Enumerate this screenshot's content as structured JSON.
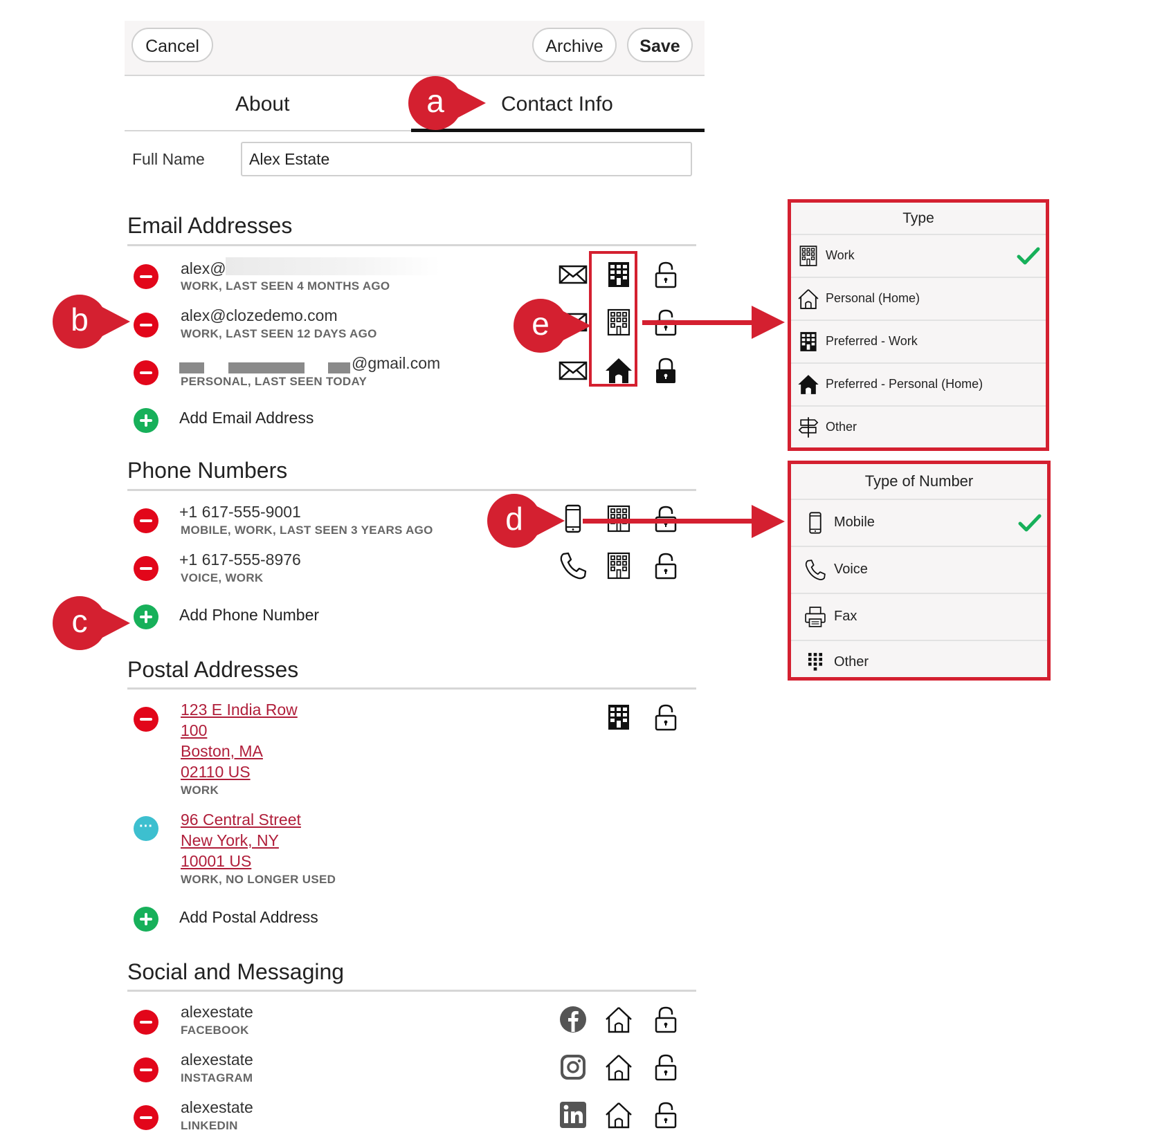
{
  "toolbar": {
    "cancel": "Cancel",
    "archive": "Archive",
    "save": "Save"
  },
  "tabs": {
    "about": "About",
    "contact_info": "Contact Info",
    "active": "contact_info"
  },
  "full_name": {
    "label": "Full Name",
    "value": "Alex Estate"
  },
  "email": {
    "title": "Email Addresses",
    "items": [
      {
        "address": "alex@",
        "meta": "WORK, LAST SEEN 4 MONTHS AGO",
        "type_icon": "building-icon"
      },
      {
        "address": "alex@clozedemo.com",
        "meta": "WORK, LAST SEEN 12 DAYS AGO",
        "type_icon": "building-icon"
      },
      {
        "address": "@gmail.com",
        "meta": "PERSONAL, LAST SEEN TODAY",
        "type_icon": "home-solid-icon"
      }
    ],
    "add": "Add Email Address"
  },
  "phone": {
    "title": "Phone Numbers",
    "items": [
      {
        "number": "+1 617-555-9001",
        "meta": "MOBILE, WORK, LAST SEEN 3 YEARS AGO",
        "kind_icon": "mobile-icon"
      },
      {
        "number": "+1 617-555-8976",
        "meta": "VOICE, WORK",
        "kind_icon": "phone-handset-icon"
      }
    ],
    "add": "Add Phone Number"
  },
  "postal": {
    "title": "Postal Addresses",
    "items": [
      {
        "lines": [
          "123 E India Row",
          "100",
          "Boston, MA",
          "02110 US"
        ],
        "meta": "WORK"
      },
      {
        "lines": [
          "96 Central Street",
          "New York, NY",
          "10001 US"
        ],
        "meta": "WORK, NO LONGER USED"
      }
    ],
    "add": "Add Postal Address"
  },
  "social": {
    "title": "Social and Messaging",
    "items": [
      {
        "handle": "alexestate",
        "network": "FACEBOOK",
        "icon": "facebook-icon"
      },
      {
        "handle": "alexestate",
        "network": "INSTAGRAM",
        "icon": "instagram-icon"
      },
      {
        "handle": "alexestate",
        "network": "LINKEDIN",
        "icon": "linkedin-icon"
      }
    ]
  },
  "annotations": {
    "a": "a",
    "b": "b",
    "c": "c",
    "d": "d",
    "e": "e"
  },
  "type_panel": {
    "title": "Type",
    "options": [
      {
        "label": "Work",
        "icon": "building-outline-icon",
        "selected": true
      },
      {
        "label": "Personal (Home)",
        "icon": "home-outline-icon",
        "selected": false
      },
      {
        "label": "Preferred - Work",
        "icon": "building-solid-icon",
        "selected": false
      },
      {
        "label": "Preferred - Personal (Home)",
        "icon": "home-solid-icon",
        "selected": false
      },
      {
        "label": "Other",
        "icon": "signpost-icon",
        "selected": false
      }
    ]
  },
  "number_panel": {
    "title": "Type of Number",
    "options": [
      {
        "label": "Mobile",
        "icon": "mobile-icon",
        "selected": true
      },
      {
        "label": "Voice",
        "icon": "phone-handset-icon",
        "selected": false
      },
      {
        "label": "Fax",
        "icon": "fax-icon",
        "selected": false
      },
      {
        "label": "Other",
        "icon": "keypad-icon",
        "selected": false
      }
    ]
  },
  "colors": {
    "accent_red": "#d42030",
    "remove_red": "#e2061a",
    "add_green": "#17b05a",
    "link": "#b01e3a",
    "check_green": "#17b05a"
  }
}
